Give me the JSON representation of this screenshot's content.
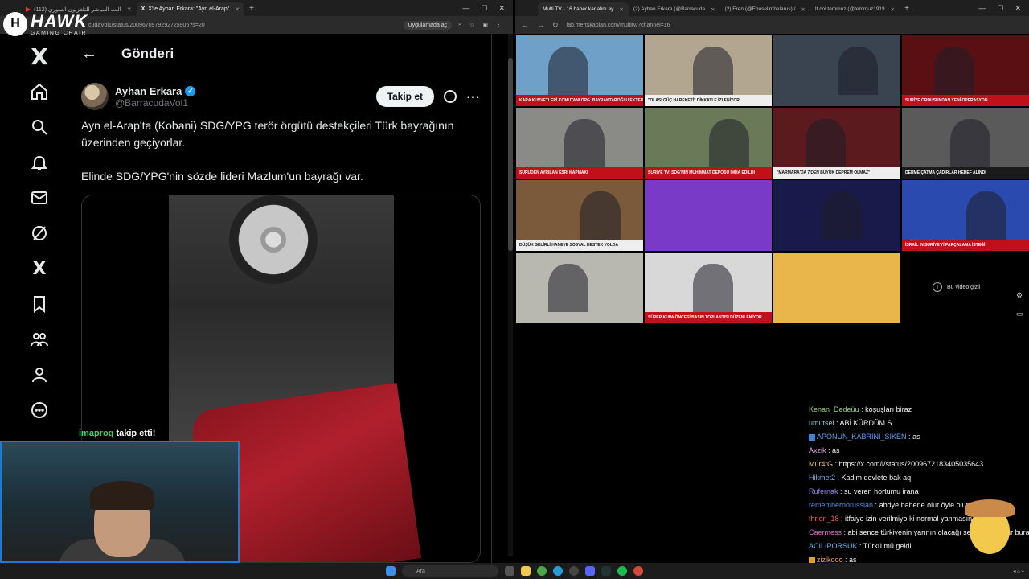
{
  "left_browser": {
    "tabs": [
      {
        "label": "البث المباشر للتلفزيون السوري (112)"
      },
      {
        "label": "X'te Ayhan Erkara: \"Ayn el-Arap\""
      }
    ],
    "url": "cudaVol1/status/2009670979292725906?s=20",
    "open_in_app": "Uygulamada aç"
  },
  "overlay": {
    "brand_name": "HAWK",
    "brand_sub": "GAMING CHAIR",
    "follow_user": "imaproq",
    "follow_text": " takip etti!"
  },
  "x": {
    "page_title": "Gönderi",
    "author_name": "Ayhan Erkara",
    "author_handle": "@BarracudaVol1",
    "follow_label": "Takip et",
    "post_line1": "Ayn el-Arap'ta (Kobani) SDG/YPG terör örgütü destekçileri Türk bayrağının üzerinden geçiyorlar.",
    "post_line2": "Elinde SDG/YPG'nin sözde lideri Mazlum'un bayrağı var."
  },
  "right_browser": {
    "tabs": [
      {
        "label": "Multi TV - 16 haber kanalını ay"
      },
      {
        "label": "(2) Ayhan Erkara (@Barracuda"
      },
      {
        "label": "(2) Eren (@Ebuselimbelarus) /"
      },
      {
        "label": "It col temmuz (@temmuz1919"
      }
    ],
    "url": "lab.mertskaplan.com/multitv/?channel=16",
    "hidden_video": "Bu video gizli"
  },
  "tv_grid": [
    {
      "ticker": "KARA KUVVETLERİ KOMUTANI ORG. BAYRAKTAROĞLU EKTEDEN ZİYARET",
      "style": "red",
      "bg": "#6fa0c8"
    },
    {
      "ticker": "\"OLASI GÜÇ HAREKETİ\" DİKKATLE İZLENİYOR",
      "style": "white",
      "bg": "#b2a690"
    },
    {
      "ticker": "",
      "style": "dark",
      "bg": "#3a4450"
    },
    {
      "ticker": "SURİYE ORDUSUNDAN YENİ OPERASYON",
      "style": "red",
      "bg": "#5a1012"
    },
    {
      "ticker": "SÜRÜDEN AYRILAN ESRİ KAPMAKI",
      "style": "red",
      "bg": "#8a8a86"
    },
    {
      "ticker": "SURİYE TV: SDG'NİN MÜHİMMAT DEPOSU İMHA EDİLDİ",
      "style": "red",
      "bg": "#6a7a58"
    },
    {
      "ticker": "\"MARMARA'DA 7'DEN BÜYÜK DEPREM OLMAZ\"",
      "style": "white",
      "bg": "#5a1a1e"
    },
    {
      "ticker": "DERME ÇATMA ÇADIRLAR HEDEF ALINDI",
      "style": "dark",
      "bg": "#5a5a5a"
    },
    {
      "ticker": "DÜŞÜK GELİRLİ HANEYE SOSYAL DESTEK YOLDA",
      "style": "white",
      "bg": "#7a5a3a"
    },
    {
      "ticker": "",
      "style": "dark",
      "bg": "#7a3ac8"
    },
    {
      "ticker": "",
      "style": "dark",
      "bg": "#1a1a4a"
    },
    {
      "ticker": "İSRAİL İN SURİYE'Yİ PARÇALAMA İSTEĞİ",
      "style": "red",
      "bg": "#2a4ab0"
    },
    {
      "ticker": "",
      "style": "dark",
      "bg": "#b8b8b0"
    },
    {
      "ticker": "SÜPER KUPA ÖNCESİ BASIN TOPLANTISI DÜZENLENİYOR",
      "style": "red",
      "bg": "#d8d8d8"
    },
    {
      "ticker": "",
      "style": "dark",
      "bg": "#e8b64a"
    },
    {
      "ticker": "",
      "style": "dark",
      "bg": "#000000"
    }
  ],
  "chat": [
    {
      "user": "Kenan_Dedeüu",
      "color": "#9ad07a",
      "msg": "koşuşları biraz"
    },
    {
      "user": "umutsel",
      "color": "#7ad0e0",
      "msg": "ABİ KÜRDÜM S"
    },
    {
      "user": "APONUN_KABRINI_SIKEN",
      "color": "#5aa0f0",
      "msg": "as",
      "badge": "blue"
    },
    {
      "user": "Axzik",
      "color": "#e0a0e0",
      "msg": "as"
    },
    {
      "user": "Mur4tG",
      "color": "#f0d060",
      "msg": "https://x.com/i/status/2009672183405035643"
    },
    {
      "user": "Hikmet2",
      "color": "#80b0f0",
      "msg": "Kadim devlete bak aq"
    },
    {
      "user": "Rufernak",
      "color": "#a080f0",
      "msg": "su veren hortumu irana"
    },
    {
      "user": "remembernorussian",
      "color": "#5a8af0",
      "msg": "abdye bahene olur öyle olursa"
    },
    {
      "user": "thrion_18",
      "color": "#f06060",
      "msg": "itfaiye izin verilmiyo ki normal yanmasın"
    },
    {
      "user": "Caermess",
      "color": "#e06ad0",
      "msg": "abi sence türkiyenin yarının olacağı senaryo ne olur buradan"
    },
    {
      "user": "ACILIPORSUK",
      "color": "#60c0f0",
      "msg": "Türkü mü geldi"
    },
    {
      "user": "zizikooo",
      "color": "#f0a050",
      "msg": "as",
      "badge": "gold"
    }
  ],
  "taskbar": {
    "search_placeholder": "Ara"
  }
}
